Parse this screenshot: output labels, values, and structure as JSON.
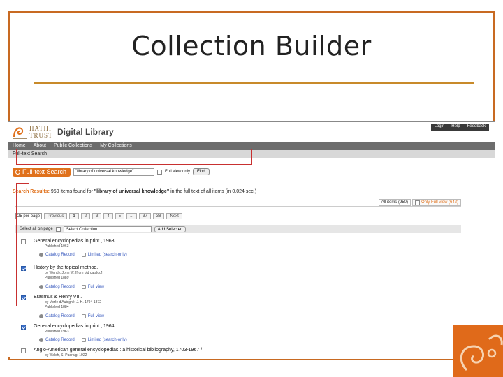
{
  "slide": {
    "title": "Collection Builder"
  },
  "header": {
    "logo_line1": "HATHI",
    "logo_line2": "TRUST",
    "brand": "Digital Library",
    "util_links": [
      "Login",
      "Help",
      "Feedback"
    ]
  },
  "nav": {
    "items": [
      "Home",
      "About",
      "Public Collections",
      "My Collections"
    ]
  },
  "subnav": {
    "label": "Full-text Search"
  },
  "search": {
    "button_label": "Full-text Search",
    "query": "\"library of universal knowledge\"",
    "full_view_label": "Full view only",
    "find_label": "Find"
  },
  "results": {
    "prefix": "Search Results:",
    "middle": " 950 items found for ",
    "query": "\"library of universal knowledge\"",
    "suffix": " in the full text of all items (in 0.024 sec.)"
  },
  "tabs": {
    "all": "All items (950)",
    "full": "Only Full view (642)"
  },
  "pager": {
    "per_page": "25 per page",
    "prev": "Previous",
    "pages": [
      "1",
      "2",
      "3",
      "4",
      "5",
      "...",
      "37",
      "38"
    ],
    "next": "Next"
  },
  "select_row": {
    "select_all_label": "Select all on page",
    "collection_placeholder": "Select Collection",
    "add_label": "Add Selected"
  },
  "items": [
    {
      "title": "General encyclopedias in print , 1963",
      "by": "",
      "published": "Published 1963",
      "links": [
        "Catalog Record",
        "Limited (search-only)"
      ],
      "checked": false
    },
    {
      "title": "History by the topical method.",
      "by": "by Wendy, John W. [from old catalog]",
      "published": "Published 1889",
      "links": [
        "Catalog Record",
        "Full view"
      ],
      "checked": true
    },
    {
      "title": "Erasmus & Henry VIII.",
      "by": "by Merle d'Aubigné, J. H. 1794-1872",
      "published": "Published 1884",
      "links": [
        "Catalog Record",
        "Full view"
      ],
      "checked": true
    },
    {
      "title": "General encyclopedias in print , 1964",
      "by": "",
      "published": "Published 1963",
      "links": [
        "Catalog Record",
        "Limited (search-only)"
      ],
      "checked": true
    },
    {
      "title": "Anglo-American general encyclopedias : a historical bibliography, 1703-1967 /",
      "by": "by Walsh, S. Padraig, 1922-",
      "published": "",
      "links": [],
      "checked": false
    }
  ],
  "colors": {
    "accent": "#e0711c",
    "frame": "#c86a22",
    "highlight": "#c83030"
  }
}
